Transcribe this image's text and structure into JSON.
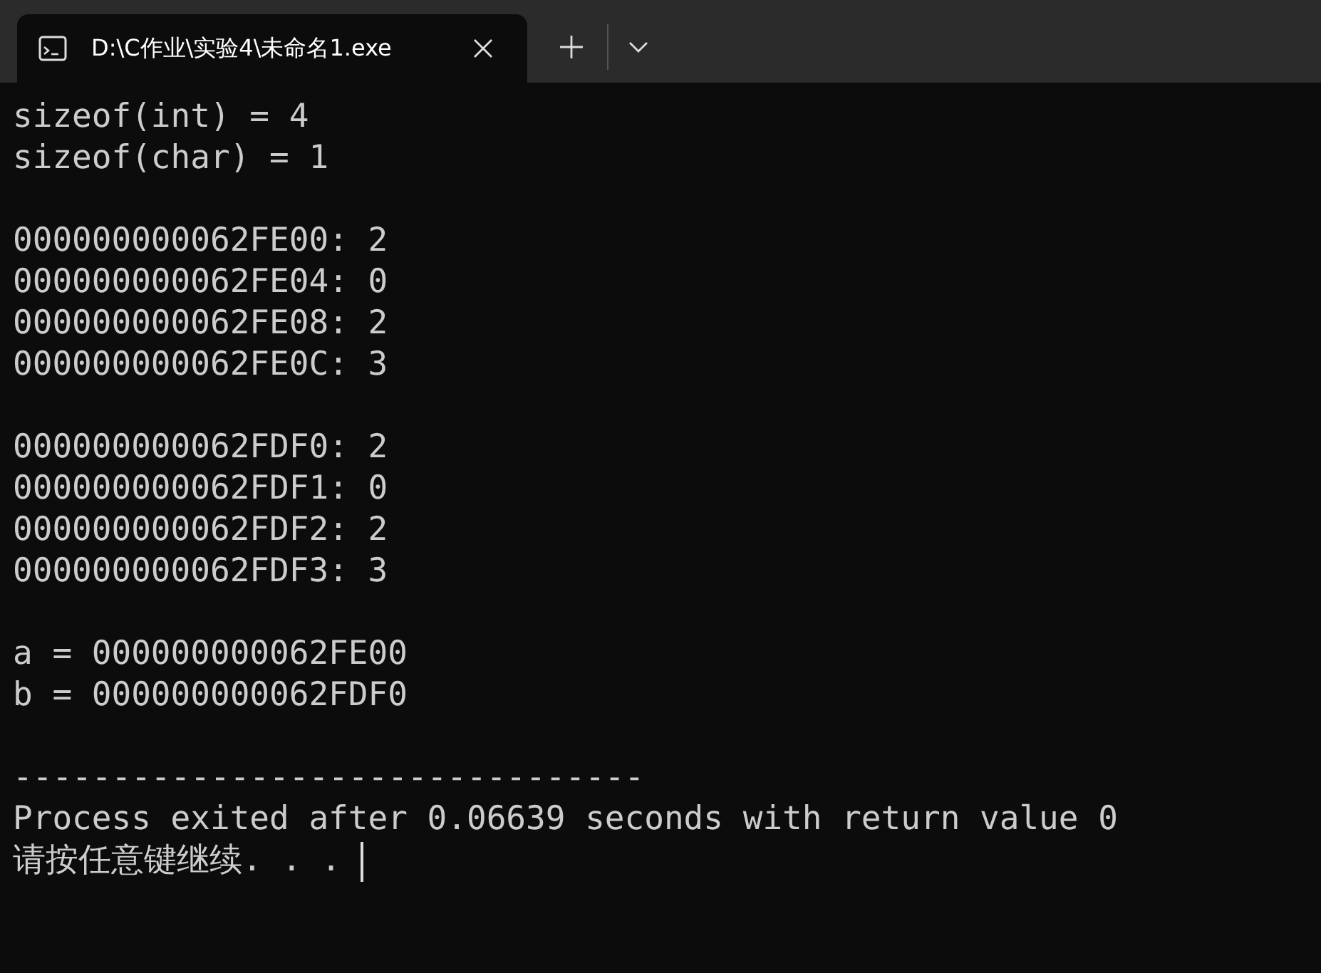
{
  "tabs": [
    {
      "title": "D:\\C作业\\实验4\\未命名1.exe",
      "selected": true
    }
  ],
  "console": {
    "blocks": [
      [
        "sizeof(int) = 4",
        "sizeof(char) = 1"
      ],
      [
        "000000000062FE00: 2",
        "000000000062FE04: 0",
        "000000000062FE08: 2",
        "000000000062FE0C: 3"
      ],
      [
        "000000000062FDF0: 2",
        "000000000062FDF1: 0",
        "000000000062FDF2: 2",
        "000000000062FDF3: 3"
      ],
      [
        "a = 000000000062FE00",
        "b = 000000000062FDF0"
      ],
      [
        "--------------------------------",
        "Process exited after 0.06639 seconds with return value 0",
        "请按任意键继续. . ."
      ]
    ],
    "cursor_visible": true
  }
}
